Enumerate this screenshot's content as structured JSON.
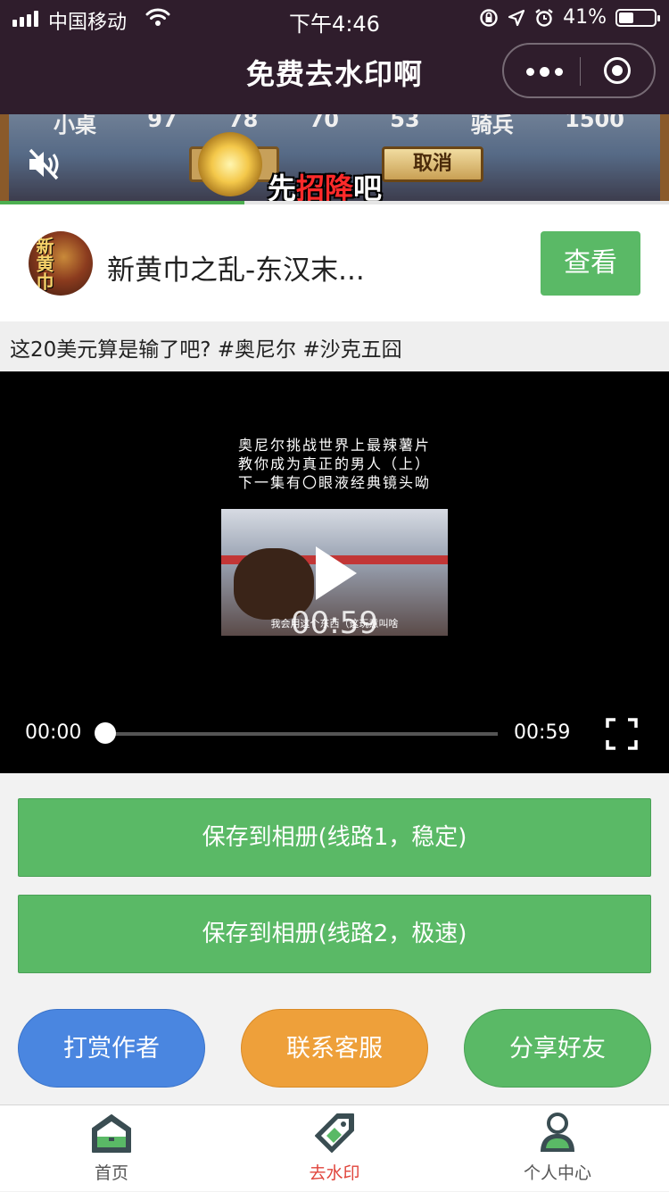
{
  "status_bar": {
    "carrier": "中国移动",
    "time": "下午4:46",
    "battery": "41%",
    "battery_level": 0.41
  },
  "nav": {
    "title": "免费去水印啊"
  },
  "ad": {
    "stats": [
      "小桌",
      "97",
      "78",
      "70",
      "53",
      "骑兵",
      "1500"
    ],
    "cancel_label": "取消",
    "caption_pre": "先",
    "caption_highlight": "招降",
    "caption_post": "吧",
    "progress": 0.365,
    "colors": {
      "progress": "#4caf50"
    }
  },
  "game_card": {
    "avatar_text": "新黄巾",
    "name": "新黄巾之乱-东汉末...",
    "view_button": "查看"
  },
  "video": {
    "title": "这20美元算是输了吧? #奥尼尔 #沙克五囧",
    "subtitle_lines": [
      "奥尼尔挑战世界上最辣薯片",
      "教你成为真正的男人（上）",
      "下一集有〇眼液经典镜头呦"
    ],
    "thumb_subtitle": "我会用这个东西（这玩意叫啥",
    "duration_center": "00:59",
    "current_time": "00:00",
    "duration": "00:59",
    "playback_progress": 0.0
  },
  "actions": {
    "save_line1": "保存到相册(线路1，稳定)",
    "save_line2": "保存到相册(线路2，极速)",
    "reward": "打赏作者",
    "contact": "联系客服",
    "share": "分享好友",
    "colors": {
      "green": "#5ab966",
      "blue": "#4a86e0",
      "orange": "#eea03a",
      "share": "#5ab966"
    }
  },
  "tabbar": {
    "items": [
      {
        "label": "首页",
        "icon": "home-icon",
        "active": false
      },
      {
        "label": "去水印",
        "icon": "tag-icon",
        "active": true
      },
      {
        "label": "个人中心",
        "icon": "user-icon",
        "active": false
      }
    ],
    "active_color": "#e0453c"
  }
}
